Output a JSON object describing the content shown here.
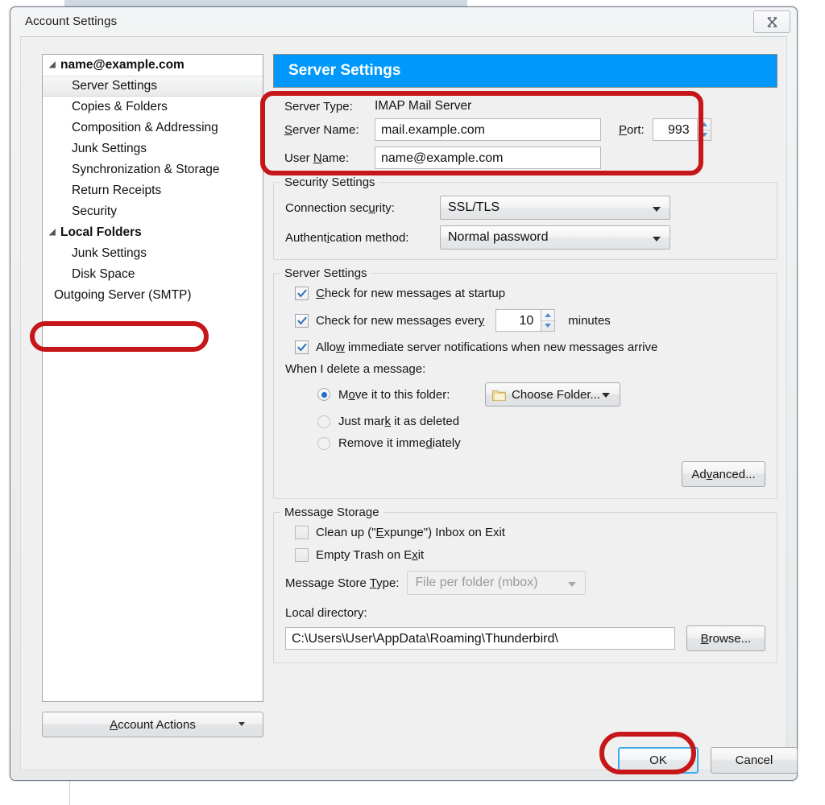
{
  "window": {
    "title": "Account Settings",
    "close_icon": "close-icon"
  },
  "sidebar": {
    "items": [
      {
        "label": "name@example.com",
        "level": "account",
        "twisty": "⊿",
        "selected": false
      },
      {
        "label": "Server Settings",
        "level": "child",
        "selected": true
      },
      {
        "label": "Copies & Folders",
        "level": "child",
        "selected": false
      },
      {
        "label": "Composition & Addressing",
        "level": "child",
        "selected": false
      },
      {
        "label": "Junk Settings",
        "level": "child",
        "selected": false
      },
      {
        "label": "Synchronization & Storage",
        "level": "child",
        "selected": false
      },
      {
        "label": "Return Receipts",
        "level": "child",
        "selected": false
      },
      {
        "label": "Security",
        "level": "child",
        "selected": false
      },
      {
        "label": "Local Folders",
        "level": "account",
        "twisty": "⊿",
        "selected": false
      },
      {
        "label": "Junk Settings",
        "level": "child",
        "selected": false
      },
      {
        "label": "Disk Space",
        "level": "child",
        "selected": false
      },
      {
        "label": "Outgoing Server (SMTP)",
        "level": "smtp",
        "selected": false
      }
    ],
    "account_actions": {
      "label": "Account Actions",
      "accel": "A",
      "arrow_icon": "chevron-down-icon"
    }
  },
  "pane": {
    "header_title": "Server Settings",
    "header_color": "#0099fb",
    "server_identity": {
      "server_type_label": "Server Type:",
      "server_type_value": "IMAP Mail Server",
      "server_name_label": "Server Name:",
      "server_name_accel": "S",
      "server_name_value": "mail.example.com",
      "user_name_label": "User Name:",
      "user_name_accel": "N",
      "user_name_value": "name@example.com",
      "port_label": "Port:",
      "port_accel": "P",
      "port_value": "993"
    },
    "security_settings": {
      "title": "Security Settings",
      "connection_security_label": "Connection security:",
      "connection_security_value": "SSL/TLS",
      "authentication_method_label": "Authentication method:",
      "authentication_method_value": "Normal password"
    },
    "server_settings": {
      "title": "Server Settings",
      "check_startup": {
        "label": "Check for new messages at startup",
        "checked": true,
        "accel": "C"
      },
      "check_interval": {
        "label": "Check for new messages every",
        "checked": true,
        "value": "10",
        "unit": "minutes"
      },
      "allow_notifications": {
        "label": "Allow immediate server notifications when new messages arrive",
        "checked": true,
        "accel": "w"
      },
      "delete_prompt": "When I delete a message:",
      "delete_options": [
        {
          "label": "Move it to this folder:",
          "selected": true
        },
        {
          "label": "Just mark it as deleted",
          "selected": false
        },
        {
          "label": "Remove it immediately",
          "selected": false
        }
      ],
      "choose_folder_label": "Choose Folder...",
      "choose_folder_icon": "folder-icon",
      "advanced_label": "Advanced..."
    },
    "message_storage": {
      "title": "Message Storage",
      "clean_up": {
        "label": "Clean up (\"Expunge\") Inbox on Exit",
        "checked": false
      },
      "empty_trash": {
        "label": "Empty Trash on Exit",
        "checked": false
      },
      "store_type_label": "Message Store Type:",
      "store_type_value": "File per folder (mbox)",
      "store_type_disabled": true,
      "local_directory_label": "Local directory:",
      "local_directory_value": "C:\\Users\\User\\AppData\\Roaming\\Thunderbird\\",
      "browse_label": "Browse..."
    }
  },
  "footer": {
    "ok_label": "OK",
    "cancel_label": "Cancel"
  },
  "annotations": {
    "color": "#c7161a",
    "regions": [
      "server-identity-fields",
      "outgoing-server-smtp-item",
      "ok-button"
    ]
  }
}
